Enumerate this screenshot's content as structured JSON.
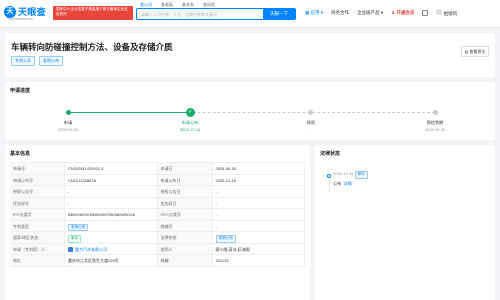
{
  "header": {
    "logo_mark": "天",
    "logo_text": "天眼查",
    "logo_sub": "TianYancha.com",
    "gov_badge_text": "国家中小企业发展子基金旗下官方备案企业征信机构",
    "search_tabs": [
      "查公司",
      "查老板",
      "查关系",
      "查风险"
    ],
    "search_placeholder": "请输入公司名称、人名、品牌名称等关键词",
    "search_button": "天眼一下",
    "nav": {
      "app": "应用",
      "business_service": "商务合作",
      "enterprise_products": "企业级产品",
      "vip": "开通会员",
      "username": "姐嗖风"
    }
  },
  "title": {
    "text": "车辆转向防碰撞控制方法、设备及存储介质",
    "tags": [
      "专利公开",
      "发明公布"
    ],
    "view_original": "查看原文"
  },
  "progress": {
    "section_title": "申请进度",
    "steps": [
      {
        "label": "申请",
        "date": "2025-09-30",
        "state": "done"
      },
      {
        "label": "申请公布",
        "date": "2025-12-16",
        "state": "current"
      },
      {
        "label": "授权",
        "date": "-",
        "state": "pending"
      },
      {
        "label": "预估到期",
        "date": "2045-09-30",
        "state": "pending"
      }
    ],
    "current_mark": "✓"
  },
  "basic_info": {
    "section_title": "基本信息",
    "rows": [
      {
        "k1": "申请号",
        "v1": "CN202511420011.X",
        "k2": "申请日",
        "v2": "2025-09-30"
      },
      {
        "k1": "申请公布号",
        "v1": "CN121133887A",
        "k2": "申请公布日",
        "v2": "2025-12-16"
      },
      {
        "k1": "授权公告号",
        "v1": "-",
        "k2": "授权公告日",
        "v2": "-"
      },
      {
        "k1": "优先权号",
        "v1": "-",
        "k2": "优先权日",
        "v2": "-"
      },
      {
        "k1": "IPC分类号",
        "v1": "B60W30/09;B60W30/095;B60W50/16",
        "k2": "CPC分类号",
        "v2": "-"
      },
      {
        "k1": "专利类型",
        "v1": "发明公布",
        "k2": "商端号",
        "v2": "-"
      },
      {
        "k1": "国家/地区状态",
        "v1": "审中",
        "k2": "法律状态",
        "v2": "发明公布"
      },
      {
        "k1": "申请（专利权）人",
        "v1": "重力汽车有限公司",
        "k2": "发明人",
        "v2": "廖小隆;蒋冰;伍海银"
      },
      {
        "k1": "地址",
        "v1": "重庆市江北区鱼生大道229号",
        "k2": "邮编",
        "v2": "401133"
      }
    ]
  },
  "legal_status": {
    "section_title": "法律状态",
    "date": "2025-12-16",
    "badge": "审中",
    "status": "公布",
    "more": "详情"
  },
  "colors": {
    "brand_blue": "#0084ff",
    "success_green": "#1aad6a",
    "vip_red": "#e8463a"
  }
}
